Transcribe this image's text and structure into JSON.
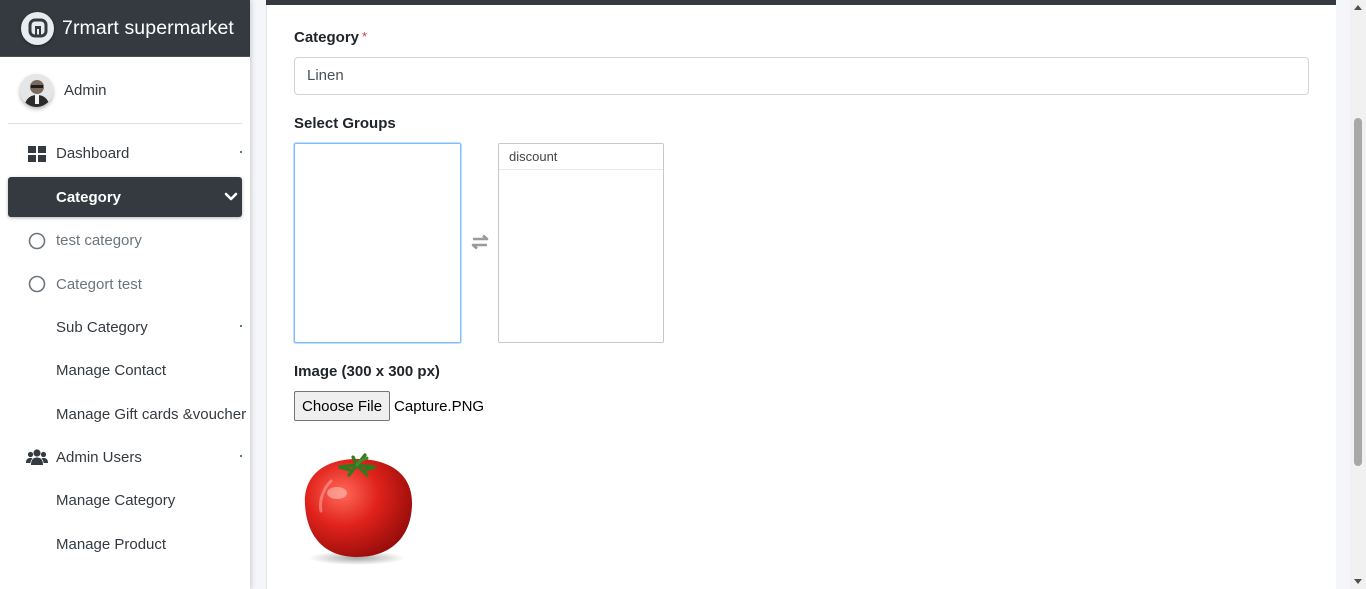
{
  "brand": {
    "name": "7rmart supermarket",
    "logo_icon": "brand-logo-icon"
  },
  "user": {
    "name": "Admin"
  },
  "sidebar": {
    "items": [
      {
        "label": "Dashboard",
        "icon": "dashboard-grid-icon"
      },
      {
        "label": "Category",
        "icon": "chevron-down-icon",
        "active": true
      },
      {
        "label": "test category",
        "icon": "circle-outline-icon"
      },
      {
        "label": "Categort test",
        "icon": "circle-outline-icon"
      },
      {
        "label": "Sub Category"
      },
      {
        "label": "Manage Contact"
      },
      {
        "label": "Manage Gift cards &voucher"
      },
      {
        "label": "Admin Users",
        "icon": "users-icon"
      },
      {
        "label": "Manage Category"
      },
      {
        "label": "Manage Product"
      }
    ]
  },
  "form": {
    "category_label": "Category",
    "required_mark": "*",
    "category_value": "Linen",
    "select_groups_label": "Select Groups",
    "available_groups": [
      "discount"
    ],
    "selected_groups": [],
    "image_label": "Image (300 x 300 px)",
    "choose_file_label": "Choose File",
    "file_name": "Capture.PNG",
    "preview_alt": "tomato"
  },
  "colors": {
    "dark": "#343a40",
    "accent_focus": "#80bdff",
    "required": "#dc3545"
  }
}
